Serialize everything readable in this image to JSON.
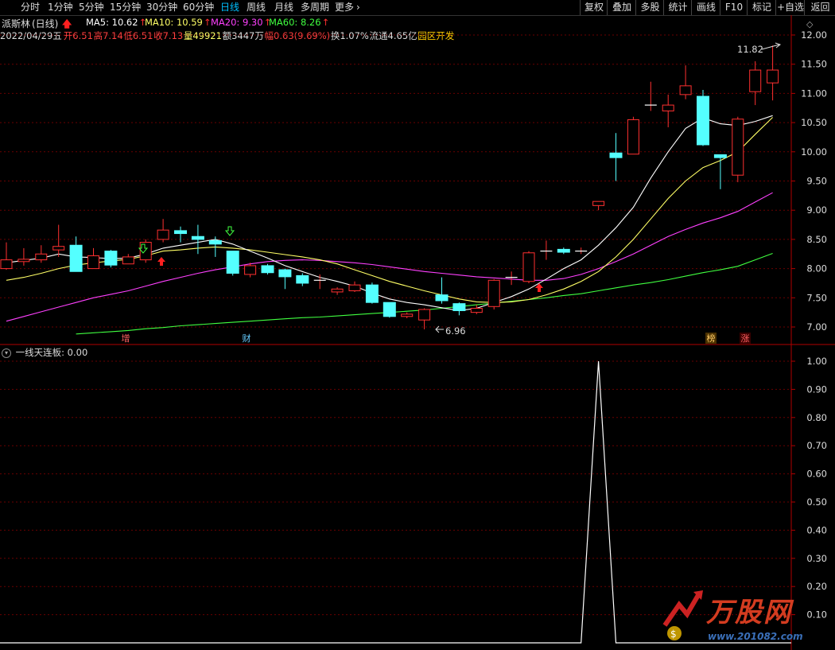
{
  "toolbar": {
    "periods": [
      {
        "label": "分时"
      },
      {
        "label": "1分钟"
      },
      {
        "label": "5分钟"
      },
      {
        "label": "15分钟"
      },
      {
        "label": "30分钟"
      },
      {
        "label": "60分钟"
      },
      {
        "label": "日线",
        "active": true
      },
      {
        "label": "周线"
      },
      {
        "label": "月线"
      },
      {
        "label": "多周期"
      },
      {
        "label": "更多"
      }
    ],
    "more_icon": "chevron-right-icon",
    "right_buttons": [
      "复权",
      "叠加",
      "多股",
      "统计",
      "画线",
      "F10",
      "标记",
      "+自选",
      "返回"
    ]
  },
  "stock": {
    "name": "派斯林",
    "period": "(日线)",
    "ma": [
      {
        "label": "MA5:",
        "value": "10.62",
        "color": "#ffffff"
      },
      {
        "label": "MA10:",
        "value": "10.59",
        "color": "#ffff66"
      },
      {
        "label": "MA20:",
        "value": "9.30",
        "color": "#ff40ff"
      },
      {
        "label": "MA60:",
        "value": "8.26",
        "color": "#40ff40"
      }
    ],
    "date": "2022/04/29五",
    "open_label": "开",
    "open": "6.51",
    "high_label": "高",
    "high": "7.14",
    "low_label": "低",
    "low": "6.51",
    "close_label": "收",
    "close": "7.13",
    "vol_label": "量",
    "vol": "49921",
    "amount_label": "额",
    "amount": "3447万",
    "range_label": "幅",
    "range": "0.63(9.69%)",
    "turnover_label": "换",
    "turnover": "1.07%",
    "float_label": "流通",
    "float_cap": "4.65亿",
    "concept": "园区开发"
  },
  "main_chart": {
    "y_ticks": [
      "12.00",
      "11.50",
      "11.00",
      "10.50",
      "10.00",
      "9.50",
      "9.00",
      "8.50",
      "8.00",
      "7.50",
      "7.00"
    ],
    "high_note": "11.82",
    "low_note": "6.96",
    "events": [
      {
        "label": "增",
        "color": "#ff6060"
      },
      {
        "label": "财",
        "color": "#66ccff"
      },
      {
        "label": "榜",
        "color": "#ffcc66"
      },
      {
        "label": "涨",
        "color": "#ff6060"
      }
    ],
    "colors": {
      "up": "#ff3030",
      "down": "#54ffff",
      "ma5": "#ffffff",
      "ma10": "#ffff66",
      "ma20": "#ff40ff",
      "ma60": "#40ff40"
    }
  },
  "chart_data": {
    "type": "candlestick",
    "candles": [
      {
        "o": 8.0,
        "c": 8.15,
        "h": 8.45,
        "l": 7.98
      },
      {
        "o": 8.12,
        "c": 8.16,
        "h": 8.35,
        "l": 8.05
      },
      {
        "o": 8.15,
        "c": 8.25,
        "h": 8.4,
        "l": 8.1
      },
      {
        "o": 8.32,
        "c": 8.38,
        "h": 8.75,
        "l": 8.2
      },
      {
        "o": 8.4,
        "c": 7.95,
        "h": 8.55,
        "l": 7.95
      },
      {
        "o": 8.0,
        "c": 8.22,
        "h": 8.35,
        "l": 8.0
      },
      {
        "o": 8.3,
        "c": 8.06,
        "h": 8.32,
        "l": 8.02
      },
      {
        "o": 8.08,
        "c": 8.2,
        "h": 8.25,
        "l": 8.08
      },
      {
        "o": 8.15,
        "c": 8.45,
        "h": 8.5,
        "l": 8.1
      },
      {
        "o": 8.5,
        "c": 8.66,
        "h": 8.85,
        "l": 8.45
      },
      {
        "o": 8.65,
        "c": 8.6,
        "h": 8.72,
        "l": 8.45
      },
      {
        "o": 8.55,
        "c": 8.5,
        "h": 8.75,
        "l": 8.25
      },
      {
        "o": 8.48,
        "c": 8.42,
        "h": 8.55,
        "l": 8.2
      },
      {
        "o": 8.3,
        "c": 7.92,
        "h": 8.3,
        "l": 7.88
      },
      {
        "o": 7.9,
        "c": 8.05,
        "h": 8.1,
        "l": 7.85
      },
      {
        "o": 8.05,
        "c": 7.93,
        "h": 8.08,
        "l": 7.9
      },
      {
        "o": 7.98,
        "c": 7.86,
        "h": 8.0,
        "l": 7.65
      },
      {
        "o": 7.88,
        "c": 7.75,
        "h": 7.92,
        "l": 7.7
      },
      {
        "o": 7.8,
        "c": 7.8,
        "h": 7.9,
        "l": 7.65
      },
      {
        "o": 7.6,
        "c": 7.65,
        "h": 7.68,
        "l": 7.55
      },
      {
        "o": 7.62,
        "c": 7.72,
        "h": 7.78,
        "l": 7.6
      },
      {
        "o": 7.72,
        "c": 7.42,
        "h": 7.76,
        "l": 7.4
      },
      {
        "o": 7.42,
        "c": 7.18,
        "h": 7.42,
        "l": 7.16
      },
      {
        "o": 7.18,
        "c": 7.22,
        "h": 7.25,
        "l": 7.15
      },
      {
        "o": 7.12,
        "c": 7.3,
        "h": 7.32,
        "l": 6.96
      },
      {
        "o": 7.55,
        "c": 7.45,
        "h": 7.85,
        "l": 7.4
      },
      {
        "o": 7.4,
        "c": 7.28,
        "h": 7.42,
        "l": 7.2
      },
      {
        "o": 7.25,
        "c": 7.32,
        "h": 7.38,
        "l": 7.22
      },
      {
        "o": 7.35,
        "c": 7.8,
        "h": 7.82,
        "l": 7.3
      },
      {
        "o": 7.85,
        "c": 7.85,
        "h": 7.95,
        "l": 7.72
      },
      {
        "o": 7.78,
        "c": 8.27,
        "h": 8.3,
        "l": 7.75
      },
      {
        "o": 8.3,
        "c": 8.3,
        "h": 8.48,
        "l": 8.15
      },
      {
        "o": 8.33,
        "c": 8.28,
        "h": 8.36,
        "l": 8.25
      },
      {
        "o": 8.3,
        "c": 8.3,
        "h": 8.36,
        "l": 8.25
      },
      {
        "o": 9.08,
        "c": 9.15,
        "h": 9.15,
        "l": 9.0
      },
      {
        "o": 9.98,
        "c": 9.9,
        "h": 10.32,
        "l": 9.5
      },
      {
        "o": 9.96,
        "c": 10.55,
        "h": 10.6,
        "l": 9.96
      },
      {
        "o": 10.8,
        "c": 10.8,
        "h": 11.2,
        "l": 10.7
      },
      {
        "o": 10.7,
        "c": 10.8,
        "h": 10.98,
        "l": 10.42
      },
      {
        "o": 10.98,
        "c": 11.13,
        "h": 11.48,
        "l": 10.9
      },
      {
        "o": 10.95,
        "c": 10.12,
        "h": 11.06,
        "l": 10.1
      },
      {
        "o": 9.95,
        "c": 9.9,
        "h": 9.95,
        "l": 9.36
      },
      {
        "o": 9.6,
        "c": 10.56,
        "h": 10.6,
        "l": 9.48
      },
      {
        "o": 11.03,
        "c": 11.4,
        "h": 11.55,
        "l": 10.8
      },
      {
        "o": 11.18,
        "c": 11.4,
        "h": 11.82,
        "l": 10.88
      }
    ],
    "ma5": [
      8.1,
      8.14,
      8.18,
      8.25,
      8.2,
      8.19,
      8.17,
      8.18,
      8.25,
      8.35,
      8.4,
      8.45,
      8.5,
      8.42,
      8.3,
      8.18,
      8.05,
      7.95,
      7.85,
      7.78,
      7.7,
      7.58,
      7.48,
      7.42,
      7.38,
      7.33,
      7.28,
      7.32,
      7.42,
      7.52,
      7.65,
      7.82,
      8.0,
      8.15,
      8.4,
      8.7,
      9.05,
      9.55,
      10.0,
      10.4,
      10.58,
      10.48,
      10.45,
      10.52,
      10.62
    ],
    "ma10": [
      7.8,
      7.85,
      7.92,
      8.0,
      8.06,
      8.1,
      8.13,
      8.16,
      8.22,
      8.3,
      8.32,
      8.35,
      8.37,
      8.35,
      8.32,
      8.28,
      8.24,
      8.2,
      8.15,
      8.08,
      7.98,
      7.88,
      7.78,
      7.7,
      7.62,
      7.55,
      7.48,
      7.43,
      7.42,
      7.43,
      7.47,
      7.55,
      7.65,
      7.78,
      7.95,
      8.2,
      8.5,
      8.85,
      9.2,
      9.5,
      9.73,
      9.85,
      10.0,
      10.3,
      10.59
    ],
    "ma20": [
      7.1,
      7.18,
      7.26,
      7.34,
      7.42,
      7.5,
      7.56,
      7.62,
      7.7,
      7.78,
      7.85,
      7.92,
      7.98,
      8.03,
      8.08,
      8.12,
      8.14,
      8.15,
      8.14,
      8.12,
      8.1,
      8.07,
      8.03,
      7.99,
      7.95,
      7.92,
      7.89,
      7.86,
      7.84,
      7.82,
      7.8,
      7.8,
      7.83,
      7.9,
      8.0,
      8.12,
      8.25,
      8.4,
      8.55,
      8.67,
      8.78,
      8.87,
      8.98,
      9.14,
      9.3
    ],
    "ma60": [
      null,
      null,
      null,
      null,
      6.88,
      6.9,
      6.92,
      6.94,
      6.97,
      6.99,
      7.02,
      7.04,
      7.06,
      7.08,
      7.1,
      7.12,
      7.14,
      7.16,
      7.17,
      7.19,
      7.21,
      7.23,
      7.25,
      7.27,
      7.29,
      7.32,
      7.35,
      7.38,
      7.41,
      7.44,
      7.47,
      7.5,
      7.54,
      7.57,
      7.62,
      7.67,
      7.72,
      7.76,
      7.81,
      7.87,
      7.93,
      7.98,
      8.04,
      8.15,
      8.26
    ]
  },
  "indicator": {
    "name": "一线天连板",
    "value_label": ": 0.00",
    "collapse_icon": "collapse-icon",
    "y_ticks": [
      "1.00",
      "0.90",
      "0.80",
      "0.70",
      "0.60",
      "0.50",
      "0.40",
      "0.30",
      "0.20",
      "0.10"
    ],
    "signal": [
      0,
      0,
      0,
      0,
      0,
      0,
      0,
      0,
      0,
      0,
      0,
      0,
      0,
      0,
      0,
      0,
      0,
      0,
      0,
      0,
      0,
      0,
      0,
      0,
      0,
      0,
      0,
      0,
      0,
      0,
      0,
      0,
      0,
      0,
      1,
      0,
      0,
      0,
      0,
      0,
      0,
      0,
      0,
      0,
      0
    ]
  },
  "watermark": {
    "brand": "万股网",
    "url": "www.201082.com"
  },
  "panel_icon": "diamond-icon"
}
